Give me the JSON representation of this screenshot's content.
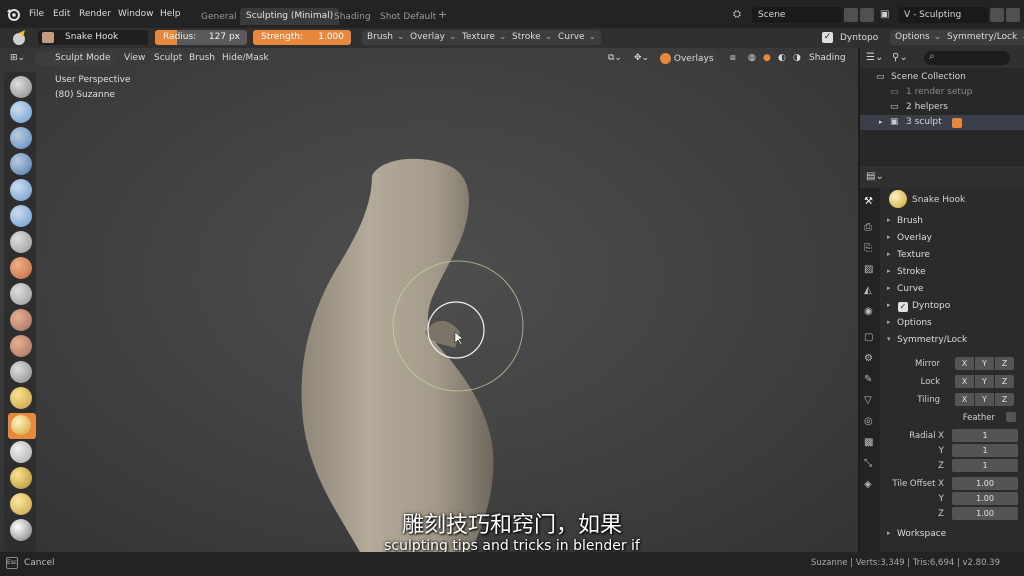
{
  "menu": {
    "file": "File",
    "edit": "Edit",
    "render": "Render",
    "window": "Window",
    "help": "Help"
  },
  "workspaces": [
    "General",
    "Sculpting (Minimal)",
    "Shading",
    "Shot Default",
    "+"
  ],
  "scene": {
    "name": "Scene",
    "view_layer": "V - Sculpting"
  },
  "tool_header": {
    "brush_name": "Snake Hook",
    "radius_label": "Radius:",
    "radius_value": "127 px",
    "strength_label": "Strength:",
    "strength_value": "1.000",
    "strength_fraction": 1.0,
    "dropdowns": [
      "Brush",
      "Overlay",
      "Texture",
      "Stroke",
      "Curve"
    ],
    "dyntopo": "Dyntopo",
    "options": "Options",
    "symmetry": "Symmetry/Lock"
  },
  "viewport_header": {
    "mode": "Sculpt Mode",
    "view": "View",
    "sculpt": "Sculpt",
    "brush": "Brush",
    "hide_mask": "Hide/Mask",
    "overlays": "Overlays",
    "shading": "Shading"
  },
  "viewport_info": {
    "perspective": "User Perspective",
    "object": "(80) Suzanne"
  },
  "outliner": {
    "items": [
      {
        "label": "Scene Collection"
      },
      {
        "label": "1 render setup"
      },
      {
        "label": "2 helpers"
      },
      {
        "label": "3 sculpt"
      }
    ]
  },
  "properties": {
    "brush_name": "Snake Hook",
    "panels": [
      "Brush",
      "Overlay",
      "Texture",
      "Stroke",
      "Curve",
      "Dyntopo",
      "Options",
      "Symmetry/Lock"
    ],
    "mirror_label": "Mirror",
    "lock_label": "Lock",
    "tiling_label": "Tiling",
    "axis_x": "X",
    "axis_y": "Y",
    "axis_z": "Z",
    "feather_label": "Feather",
    "radial_x_label": "Radial X",
    "y_label": "Y",
    "z_label": "Z",
    "radial_x": "1",
    "radial_y": "1",
    "radial_z": "1",
    "tile_offset_label": "Tile Offset X",
    "tile_x": "1.00",
    "tile_y": "1.00",
    "tile_z": "1.00",
    "workspace": "Workspace"
  },
  "status": {
    "esc": "Esc",
    "cancel": "Cancel",
    "stats": "Suzanne | Verts:3,349 | Tris:6,694 | v2.80.39"
  },
  "subtitles": {
    "chinese": "雕刻技巧和窍门，如果",
    "english": "sculpting tips and tricks in blender if"
  },
  "colors": {
    "accent": "#e8883c",
    "active_tab": "#3a3a3a",
    "panel_bg": "#2b2b2b"
  }
}
